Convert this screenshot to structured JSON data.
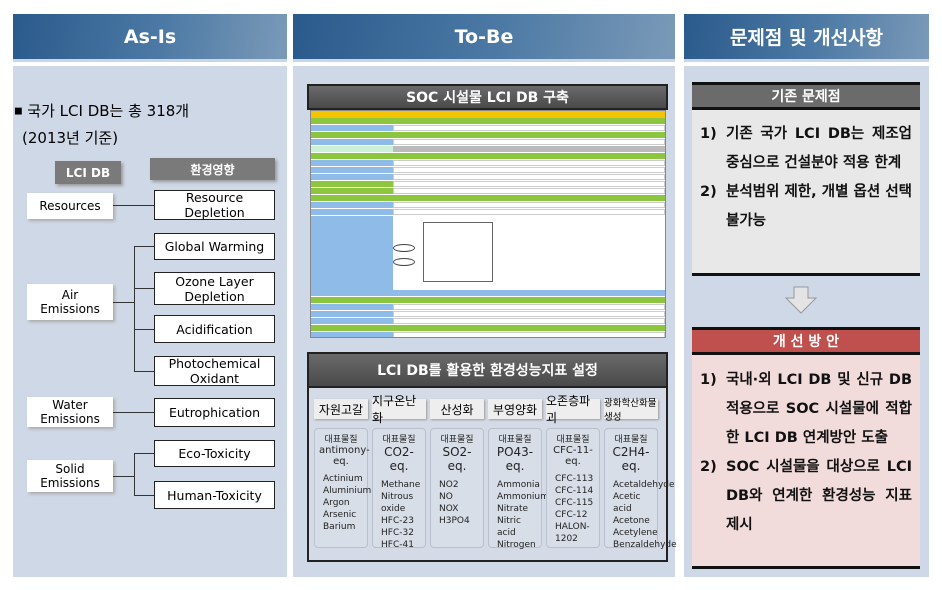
{
  "headers": {
    "as_is": "As-Is",
    "to_be": "To-Be",
    "issues": "문제점 및 개선사항"
  },
  "as_is": {
    "bullet": "국가 LCI DB는 총 318개",
    "bullet_sub": "(2013년 기준)",
    "lci_header": "LCI DB",
    "impact_header": "환경영향",
    "lci_items": [
      "Resources",
      "Air Emissions",
      "Water Emissions",
      "Solid Emissions"
    ],
    "impacts": [
      "Resource Depletion",
      "Global Warming",
      "Ozone Layer Depletion",
      "Acidification",
      "Photochemical Oxidant",
      "Eutrophication",
      "Eco-Toxicity",
      "Human-Toxicity"
    ]
  },
  "to_be": {
    "title1": "SOC 시설물 LCI DB 구축",
    "title2": "LCI DB를 활용한 환경성능지표 설정",
    "categories": [
      {
        "name": "자원고갈",
        "rep": "대표물질",
        "eq": "antimony-eq.",
        "items": [
          "Actinium",
          "Aluminium",
          "Argon",
          "Arsenic",
          "Barium"
        ]
      },
      {
        "name": "지구온난화",
        "rep": "대표물질",
        "eq": "CO2-eq.",
        "items": [
          "Methane",
          "Nitrous oxide",
          "HFC-23",
          "HFC-32",
          "HFC-41"
        ]
      },
      {
        "name": "산성화",
        "rep": "대표물질",
        "eq": "SO2-eq.",
        "items": [
          "NO2",
          "NO",
          "NOX",
          "H3PO4"
        ]
      },
      {
        "name": "부영양화",
        "rep": "대표물질",
        "eq": "PO43-eq.",
        "items": [
          "Ammonia",
          "Ammonium",
          "Nitrate",
          "Nitric acid",
          "Nitrogen"
        ]
      },
      {
        "name": "오존층파괴",
        "rep": "대표물질",
        "eq": "CFC-11-eq.",
        "items": [
          "CFC-113",
          "CFC-114",
          "CFC-115",
          "CFC-12",
          "HALON-1202"
        ]
      },
      {
        "name": "광화학산화물생성",
        "rep": "대표물질",
        "eq": "C2H4-eq.",
        "items": [
          "Acetaldehyde",
          "Acetic acid",
          "Acetone",
          "Acetylene",
          "Benzaldehyde"
        ]
      }
    ]
  },
  "issues": {
    "problem_title": "기존 문제점",
    "problems": [
      {
        "num": "1)",
        "text": "기존 국가 LCI DB는 제조업 중심으로 건설분야 적용 한계"
      },
      {
        "num": "2)",
        "text": "분석범위 제한, 개별 옵션 선택 불가능"
      }
    ],
    "solution_title": "개 선 방 안",
    "solutions": [
      {
        "num": "1)",
        "text": "국내·외 LCI DB 및 신규 DB 적용으로 SOC 시설물에 적합한 LCI DB 연계방안 도출"
      },
      {
        "num": "2)",
        "text": "SOC 시설물을 대상으로 LCI DB와 연계한 환경성능 지표 제시"
      }
    ]
  },
  "colors": {
    "header": "#2a5a8c",
    "panel": "#cfd8e6",
    "problem_bar": "#6b6b6b",
    "solution_bar": "#c0504d",
    "solution_bg": "#f2dcdb",
    "problem_bg": "#e8e8e8"
  }
}
